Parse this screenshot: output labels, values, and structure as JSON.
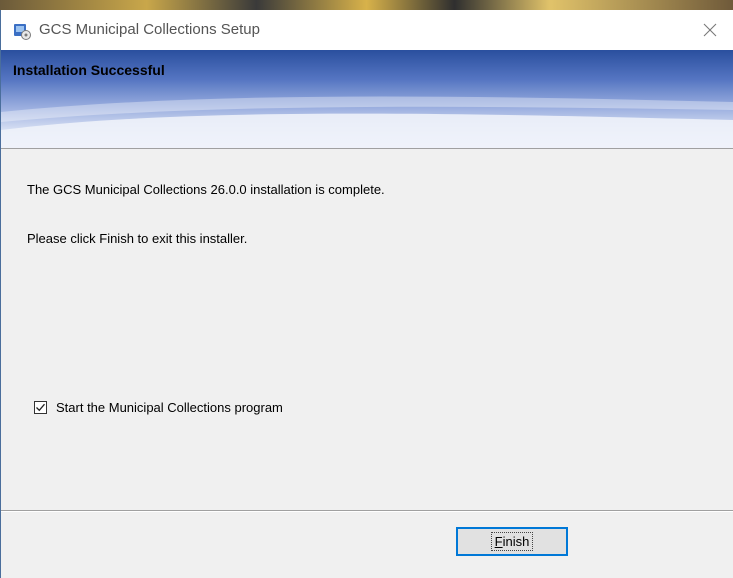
{
  "window": {
    "title": "GCS Municipal Collections Setup",
    "close_icon": "close-icon",
    "app_icon": "installer-icon"
  },
  "banner": {
    "title": "Installation Successful"
  },
  "content": {
    "line1": "The GCS Municipal Collections 26.0.0 installation is complete.",
    "line2": "Please click Finish to exit this installer.",
    "checkbox": {
      "label": "Start the Municipal Collections program",
      "checked": true
    }
  },
  "footer": {
    "finish_mnemonic": "F",
    "finish_rest": "inish"
  },
  "colors": {
    "banner_dark": "#2a4f9e",
    "banner_light": "#dfe6f6",
    "focus_border": "#0078d7"
  }
}
